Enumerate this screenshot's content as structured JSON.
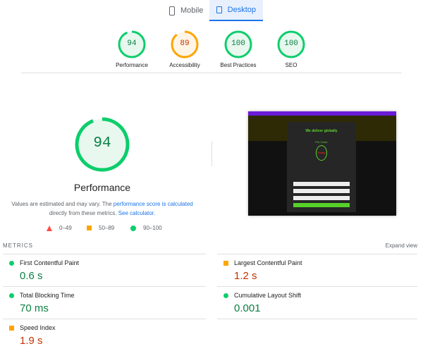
{
  "tabs": [
    {
      "label": "Mobile",
      "icon": "phone-icon"
    },
    {
      "label": "Desktop",
      "icon": "laptop-icon"
    }
  ],
  "colors": {
    "good": "#0cce6b",
    "average": "#ffa400",
    "poor": "#ff4e42",
    "link": "#1a73e8"
  },
  "scores": [
    {
      "label": "Performance",
      "value": 94,
      "rating": "good"
    },
    {
      "label": "Accessibility",
      "value": 89,
      "rating": "average"
    },
    {
      "label": "Best Practices",
      "value": 100,
      "rating": "good"
    },
    {
      "label": "SEO",
      "value": 100,
      "rating": "good"
    }
  ],
  "main": {
    "score": 94,
    "title": "Performance",
    "desc_prefix": "Values are estimated and may vary. The ",
    "desc_link1": "performance score is calculated",
    "desc_mid": " directly from these metrics. ",
    "desc_link2": "See calculator."
  },
  "legend": [
    {
      "range": "0–49",
      "shape": "triangle"
    },
    {
      "range": "50–89",
      "shape": "square"
    },
    {
      "range": "90–100",
      "shape": "circle"
    }
  ],
  "screenshot": {
    "heading": "We deliver globally",
    "pre_order": "Pre Order",
    "today": "Today"
  },
  "metrics_header": "METRICS",
  "expand_view": "Expand view",
  "metrics": [
    {
      "name": "First Contentful Paint",
      "value": "0.6 s",
      "rating": "good"
    },
    {
      "name": "Largest Contentful Paint",
      "value": "1.2 s",
      "rating": "average"
    },
    {
      "name": "Total Blocking Time",
      "value": "70 ms",
      "rating": "good"
    },
    {
      "name": "Cumulative Layout Shift",
      "value": "0.001",
      "rating": "good"
    },
    {
      "name": "Speed Index",
      "value": "1.9 s",
      "rating": "average"
    }
  ]
}
